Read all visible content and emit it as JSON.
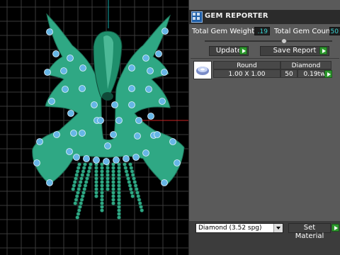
{
  "panel": {
    "title": "GEM REPORTER",
    "total_weight_label": "Total Gem Weight",
    "total_weight_value": ".19",
    "total_count_label": "Total Gem Count",
    "total_count_value": "50",
    "update_label": "Update",
    "save_report_label": "Save Report",
    "gem": {
      "shape": "Round",
      "material": "Diamond",
      "size": "1.00 X 1.00",
      "count": "50",
      "weight": "0.19tw"
    },
    "material_select": "Diamond    (3.52 spg)",
    "set_material_label": "Set Material"
  },
  "colors": {
    "body": "#2fa884",
    "gem": "#66b6e6",
    "grid": "#3a3a3a",
    "accent": "#2f9a2f"
  }
}
